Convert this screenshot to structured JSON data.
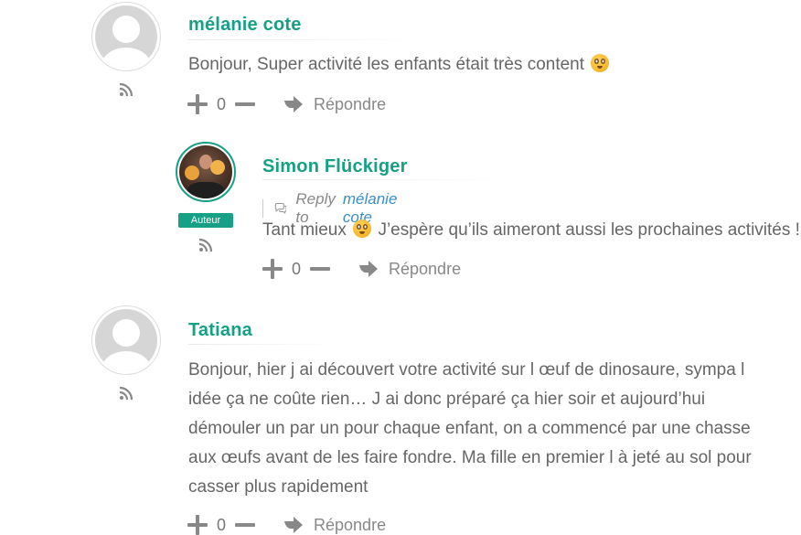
{
  "comments": [
    {
      "author": "mélanie cote",
      "text": "Bonjour, Super activité les enfants était très content",
      "votes": "0",
      "reply_label": "Répondre"
    },
    {
      "author": "Simon Flückiger",
      "badge": "Auteur",
      "reply_to_label": "Reply to",
      "reply_to_name": "mélanie cote",
      "text_before": "Tant mieux",
      "text_after": "J’espère qu’ils aimeront aussi les prochaines activités !",
      "votes": "0",
      "reply_label": "Répondre"
    },
    {
      "author": "Tatiana",
      "text_lines": [
        "Bonjour, hier j ai découvert votre activité sur l œuf de dinosaure, sympa l",
        "idée ça ne coûte rien… J ai donc préparé ça hier soir et aujourd’hui",
        "démouler un par un pour chaque enfant, on a commencé par une chasse",
        "aux œufs avant de les faire fondre. Ma fille en premier l à jeté au sol pour",
        "casser plus rapidement"
      ],
      "votes": "0",
      "reply_label": "Répondre"
    }
  ],
  "colors": {
    "accent": "#16a085",
    "link": "#3a8fc7",
    "text": "#666666",
    "muted": "#888888"
  },
  "icons": {
    "feed": "rss-feed-icon",
    "vote_up": "plus-icon",
    "vote_down": "minus-icon",
    "reply": "reply-arrow-icon",
    "reply_to": "chat-bubble-icon",
    "emoji": "smiley-emoji-icon"
  }
}
